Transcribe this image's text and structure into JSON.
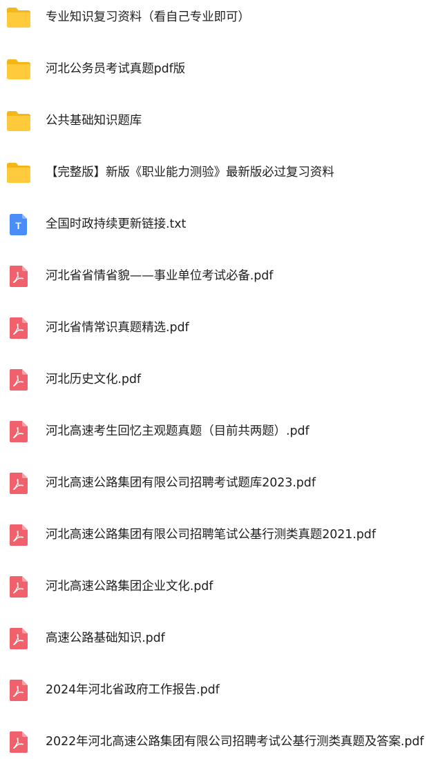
{
  "files": [
    {
      "name": "专业知识复习资料（看自己专业即可）",
      "icon": "folder-icon",
      "type": "folder"
    },
    {
      "name": "河北公务员考试真题pdf版",
      "icon": "folder-icon",
      "type": "folder"
    },
    {
      "name": "公共基础知识题库",
      "icon": "folder-icon",
      "type": "folder"
    },
    {
      "name": "【完整版】新版《职业能力测验》最新版必过复习资料",
      "icon": "folder-icon",
      "type": "folder"
    },
    {
      "name": "全国时政持续更新链接.txt",
      "icon": "txt-file-icon",
      "type": "txt",
      "icon_letter": "T"
    },
    {
      "name": "河北省省情省貌——事业单位考试必备.pdf",
      "icon": "pdf-file-icon",
      "type": "pdf"
    },
    {
      "name": "河北省情常识真题精选.pdf",
      "icon": "pdf-file-icon",
      "type": "pdf"
    },
    {
      "name": "河北历史文化.pdf",
      "icon": "pdf-file-icon",
      "type": "pdf"
    },
    {
      "name": "河北高速考生回忆主观题真题（目前共两题）.pdf",
      "icon": "pdf-file-icon",
      "type": "pdf"
    },
    {
      "name": "河北高速公路集团有限公司招聘考试题库2023.pdf",
      "icon": "pdf-file-icon",
      "type": "pdf"
    },
    {
      "name": "河北高速公路集团有限公司招聘笔试公基行测类真题2021.pdf",
      "icon": "pdf-file-icon",
      "type": "pdf"
    },
    {
      "name": "河北高速公路集团企业文化.pdf",
      "icon": "pdf-file-icon",
      "type": "pdf"
    },
    {
      "name": "高速公路基础知识.pdf",
      "icon": "pdf-file-icon",
      "type": "pdf"
    },
    {
      "name": "2024年河北省政府工作报告.pdf",
      "icon": "pdf-file-icon",
      "type": "pdf"
    },
    {
      "name": "2022年河北高速公路集团有限公司招聘考试公基行测类真题及答案.pdf",
      "icon": "pdf-file-icon",
      "type": "pdf"
    }
  ],
  "colors": {
    "folder_back": "#F5B61A",
    "folder_front": "#FFCB3D",
    "pdf": "#F0616C",
    "txt": "#4A8DF8",
    "text": "#1F1F1F"
  }
}
